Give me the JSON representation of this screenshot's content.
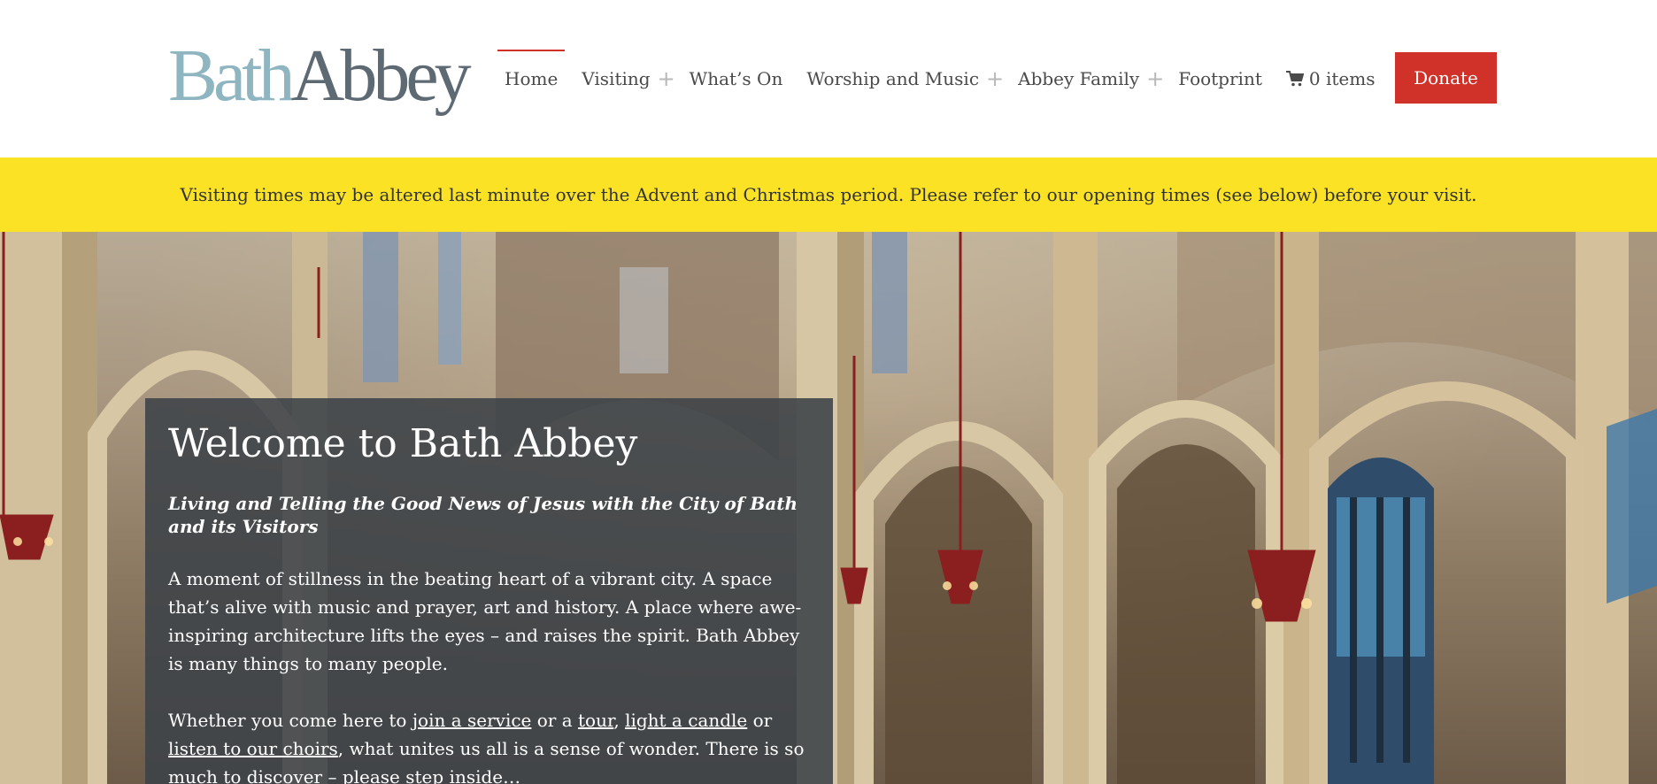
{
  "header": {
    "logo": {
      "part1": "Bath",
      "part2": "Abbey"
    },
    "nav": [
      {
        "label": "Home",
        "active": true,
        "has_submenu": false
      },
      {
        "label": "Visiting",
        "active": false,
        "has_submenu": true
      },
      {
        "label": "What’s On",
        "active": false,
        "has_submenu": false
      },
      {
        "label": "Worship and Music",
        "active": false,
        "has_submenu": true
      },
      {
        "label": "Abbey Family",
        "active": false,
        "has_submenu": true
      },
      {
        "label": "Footprint",
        "active": false,
        "has_submenu": false
      }
    ],
    "submenu_symbol": "+",
    "cart": {
      "label": "0 items",
      "icon": "cart-icon"
    },
    "donate_label": "Donate"
  },
  "notice": {
    "text": "Visiting times may be altered last minute over the Advent and Christmas period. Please refer to our opening times (see below) before your visit."
  },
  "welcome": {
    "title": "Welcome to Bath Abbey",
    "tagline": "Living and Telling the Good News of Jesus with the City of Bath and its Visitors",
    "paragraph1": "A moment of stillness in the beating heart of a vibrant city. A space that’s alive with music and prayer, art and history. A place where awe-inspiring architecture lifts the eyes – and raises the spirit. Bath Abbey is many things to many people.",
    "p2_intro": "Whether you come here to ",
    "link_service": "join a service",
    "p2_or1": " or a ",
    "link_tour": "tour",
    "p2_comma": ", ",
    "link_candle": "light a candle",
    "p2_or2": " or ",
    "link_choirs": "listen to our choirs",
    "p2_end": ", what unites us all is a sense of wonder. There is so much to discover – please step inside…"
  },
  "colors": {
    "accent_red": "#d0322a",
    "notice_yellow": "#fce225",
    "logo_light": "#8fb5c0",
    "logo_dark": "#5e6a73",
    "panel": "#3c4248"
  }
}
